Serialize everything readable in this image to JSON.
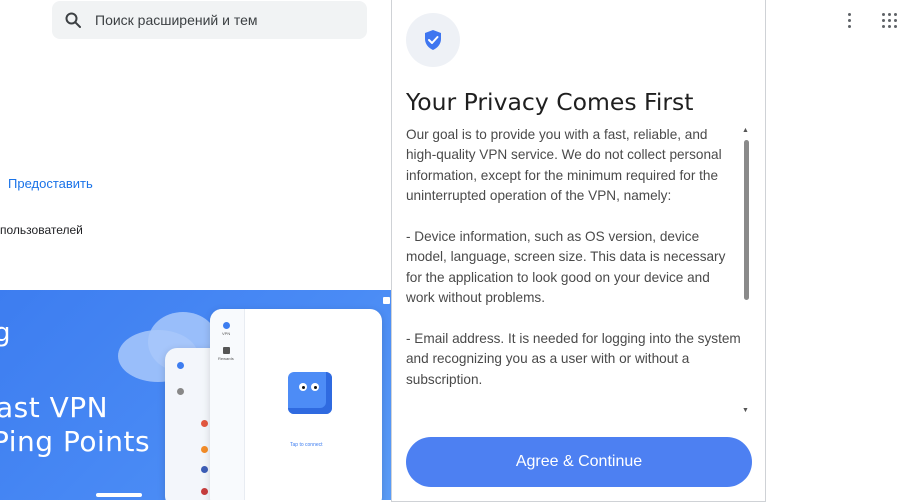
{
  "store": {
    "search_placeholder": "Поиск расширений и тем",
    "provide_link": "Предоставить",
    "users_text": "пользователей",
    "banner": {
      "word_g": "g",
      "line1": "ast VPN",
      "line2": "Ping Points",
      "mock_side_label1": "VPN",
      "mock_side_label2": "Rewards",
      "mock_tap": "Tap to connect"
    }
  },
  "popup": {
    "title": "Your Privacy Comes First",
    "paragraphs": [
      "Our goal is to provide you with a fast, reliable, and high-quality VPN service. We do not collect personal information, except for the minimum required for the uninterrupted operation of the VPN, namely:",
      "- Device information, such as OS version, device model, language, screen size. This data is necessary for the application to look good on your device and work without problems.",
      "- Email address. It is needed for logging into the system and recognizing you as a user with or without a subscription."
    ],
    "agree_label": "Agree & Continue"
  },
  "colors": {
    "accent": "#4d80f2",
    "banner": "#3d7df0",
    "link": "#1a73e8"
  },
  "icons": {
    "search": "search-icon",
    "shield": "shield-check-icon",
    "more": "more-vert-icon",
    "apps": "apps-grid-icon"
  }
}
